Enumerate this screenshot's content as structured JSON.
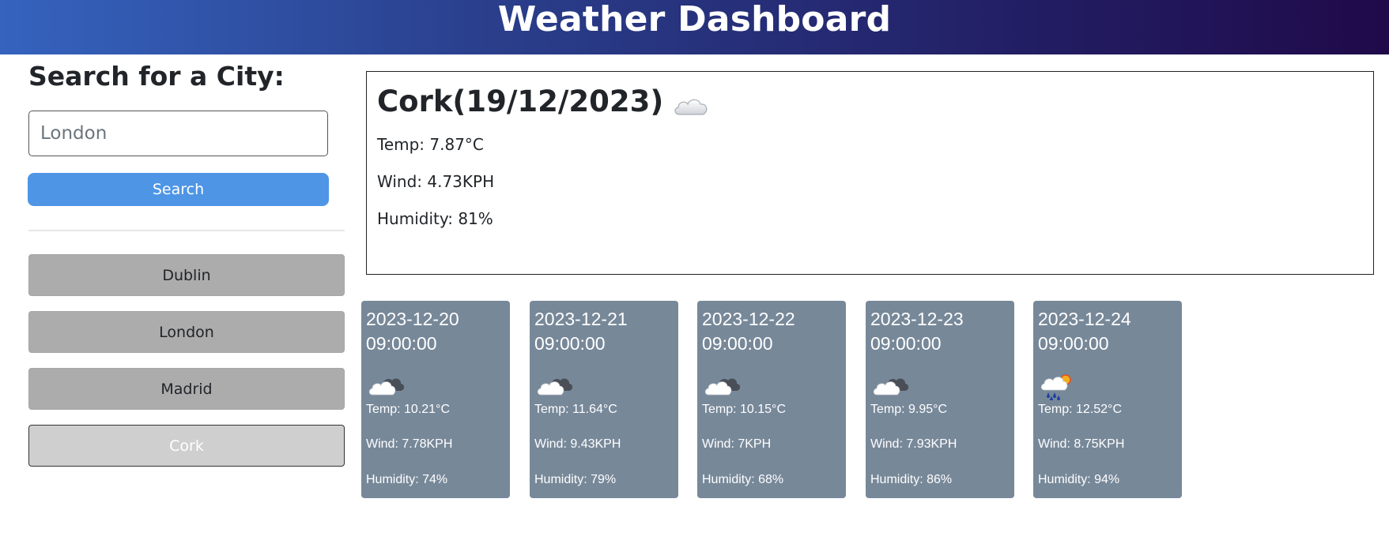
{
  "header": {
    "title": "Weather Dashboard"
  },
  "sidebar": {
    "search_title": "Search for a City:",
    "search_placeholder": "London",
    "search_value": "",
    "search_button": "Search",
    "history": [
      {
        "label": "Dublin",
        "active": false
      },
      {
        "label": "London",
        "active": false
      },
      {
        "label": "Madrid",
        "active": false
      },
      {
        "label": "Cork",
        "active": true
      }
    ]
  },
  "current": {
    "title": "Cork(19/12/2023)",
    "icon": "cloud-icon",
    "temp": "Temp: 7.87°C",
    "wind": "Wind: 4.73KPH",
    "humidity": "Humidity: 81%"
  },
  "forecast": [
    {
      "date": "2023-12-20 09:00:00",
      "icon": "partly-cloudy-icon",
      "temp": "Temp: 10.21°C",
      "wind": "Wind: 7.78KPH",
      "humidity": "Humidity: 74%"
    },
    {
      "date": "2023-12-21 09:00:00",
      "icon": "partly-cloudy-icon",
      "temp": "Temp: 11.64°C",
      "wind": "Wind: 9.43KPH",
      "humidity": "Humidity: 79%"
    },
    {
      "date": "2023-12-22 09:00:00",
      "icon": "partly-cloudy-icon",
      "temp": "Temp: 10.15°C",
      "wind": "Wind: 7KPH",
      "humidity": "Humidity: 68%"
    },
    {
      "date": "2023-12-23 09:00:00",
      "icon": "partly-cloudy-icon",
      "temp": "Temp: 9.95°C",
      "wind": "Wind: 7.93KPH",
      "humidity": "Humidity: 86%"
    },
    {
      "date": "2023-12-24 09:00:00",
      "icon": "rain-sun-icon",
      "temp": "Temp: 12.52°C",
      "wind": "Wind: 8.75KPH",
      "humidity": "Humidity: 94%"
    }
  ],
  "colors": {
    "header_gradient_start": "#3563be",
    "header_gradient_end": "#200a4a",
    "search_button": "#4e95e6",
    "history_button": "#acacac",
    "history_button_active": "#cfcfcf",
    "forecast_card": "#778899"
  }
}
